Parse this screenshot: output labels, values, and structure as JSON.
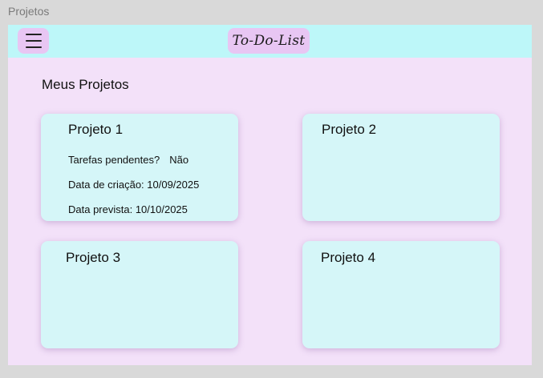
{
  "window": {
    "title": "Projetos"
  },
  "header": {
    "menu_icon": "hamburger-menu-icon",
    "brand": "To-Do-List"
  },
  "main": {
    "title": "Meus Projetos",
    "projects": [
      {
        "name": "Projeto 1",
        "pending_label": "Tarefas pendentes?",
        "pending_value": "Não",
        "created": "Data de criação: 10/09/2025",
        "due": "Data prevista: 10/10/2025"
      },
      {
        "name": "Projeto 2"
      },
      {
        "name": "Projeto 3"
      },
      {
        "name": "Projeto 4"
      }
    ]
  },
  "colors": {
    "background": "#f3e1f9",
    "topbar": "#bdf7f9",
    "button": "#e8c6f3",
    "card": "#d5f6f8"
  }
}
